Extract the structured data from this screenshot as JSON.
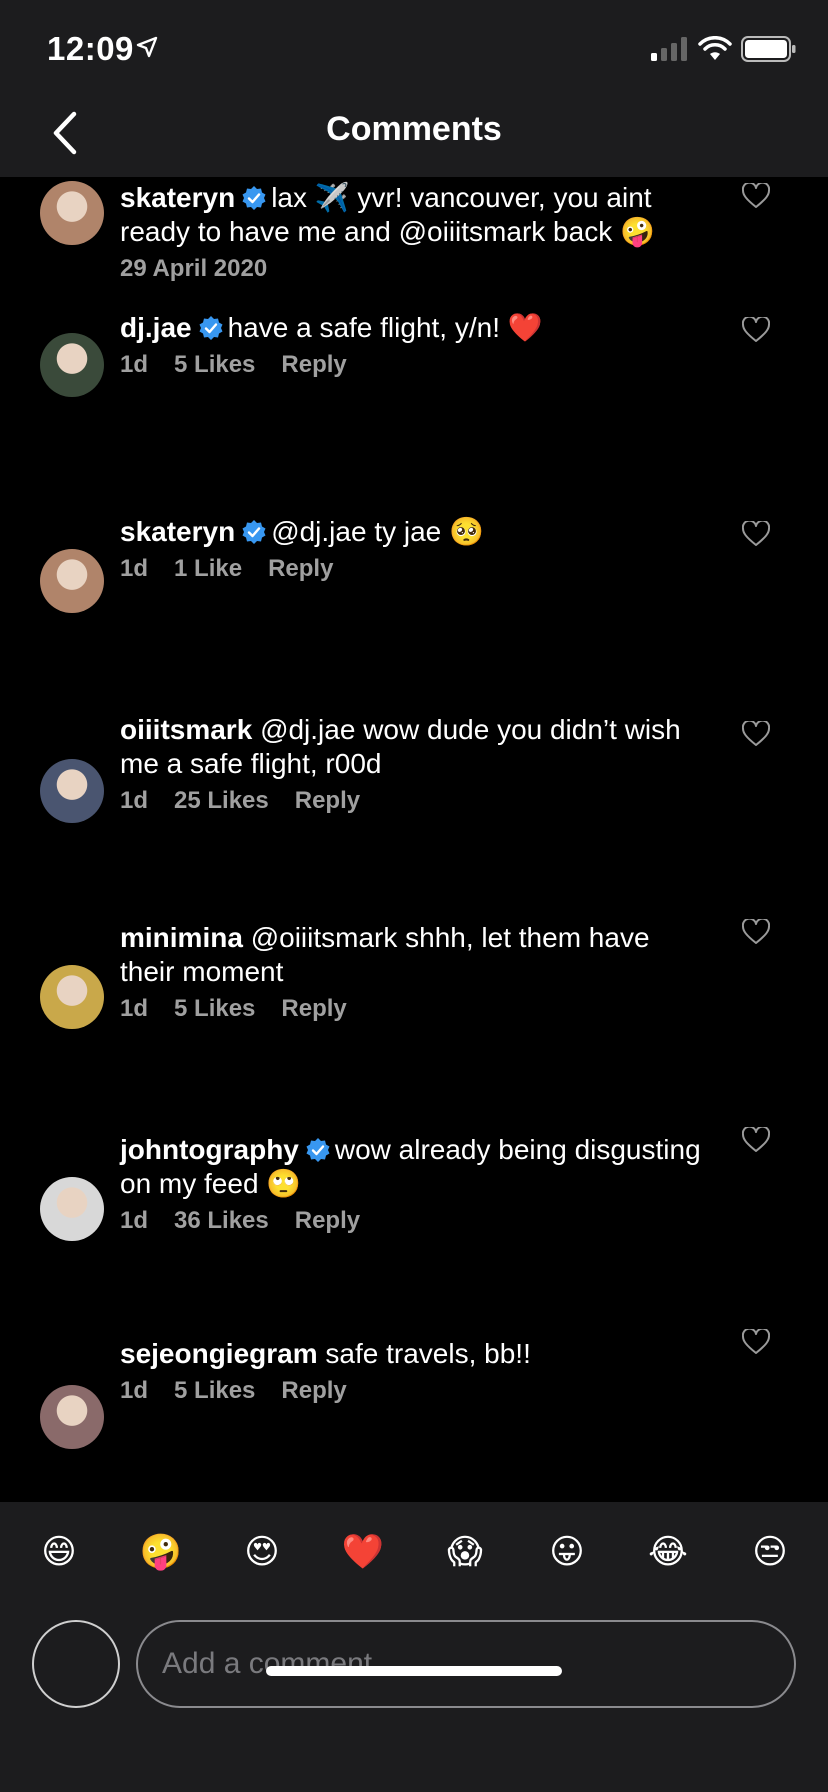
{
  "status": {
    "time": "12:09",
    "icons": [
      "location-arrow-icon",
      "signal-icon",
      "wifi-icon",
      "battery-icon"
    ]
  },
  "header": {
    "title": "Comments",
    "back_icon": "chevron-left-icon"
  },
  "comments": [
    {
      "username": "skateryn",
      "verified": true,
      "text": "lax ✈️ yvr! vancouver, you aint ready to have me and @oiiitsmark back 🤪",
      "time": "29 April 2020",
      "likes": "",
      "reply": "",
      "avatar_color": "#b0846a"
    },
    {
      "username": "dj.jae",
      "verified": true,
      "text": "have a safe flight, y/n! ❤️",
      "time": "1d",
      "likes": "5 Likes",
      "reply": "Reply",
      "avatar_color": "#3a4a3a"
    },
    {
      "username": "skateryn",
      "verified": true,
      "text": "@dj.jae ty jae 🥺",
      "time": "1d",
      "likes": "1 Like",
      "reply": "Reply",
      "avatar_color": "#b0846a"
    },
    {
      "username": "oiiitsmark",
      "verified": false,
      "text": "@dj.jae wow dude you didn’t wish me a safe flight, r00d",
      "time": "1d",
      "likes": "25 Likes",
      "reply": "Reply",
      "avatar_color": "#4a5570"
    },
    {
      "username": "minimina",
      "verified": false,
      "text": "@oiiitsmark shhh, let them have their moment",
      "time": "1d",
      "likes": "5 Likes",
      "reply": "Reply",
      "avatar_color": "#c9a84a"
    },
    {
      "username": "johntography",
      "verified": true,
      "text": "wow already being disgusting on my feed 🙄",
      "time": "1d",
      "likes": "36 Likes",
      "reply": "Reply",
      "avatar_color": "#d8d8d8"
    },
    {
      "username": "sejeongiegram",
      "verified": false,
      "text": "safe travels, bb!!",
      "time": "1d",
      "likes": "5 Likes",
      "reply": "Reply",
      "avatar_color": "#8a6a6a"
    }
  ],
  "emojis": [
    "😄",
    "🤪",
    "😍",
    "❤️",
    "😱",
    "😛",
    "😂",
    "😒"
  ],
  "composer": {
    "placeholder": "Add a comment"
  },
  "colors": {
    "background": "#000000",
    "bar": "#1c1c1e",
    "meta": "#a0a0a0",
    "verified": "#3897f0"
  }
}
